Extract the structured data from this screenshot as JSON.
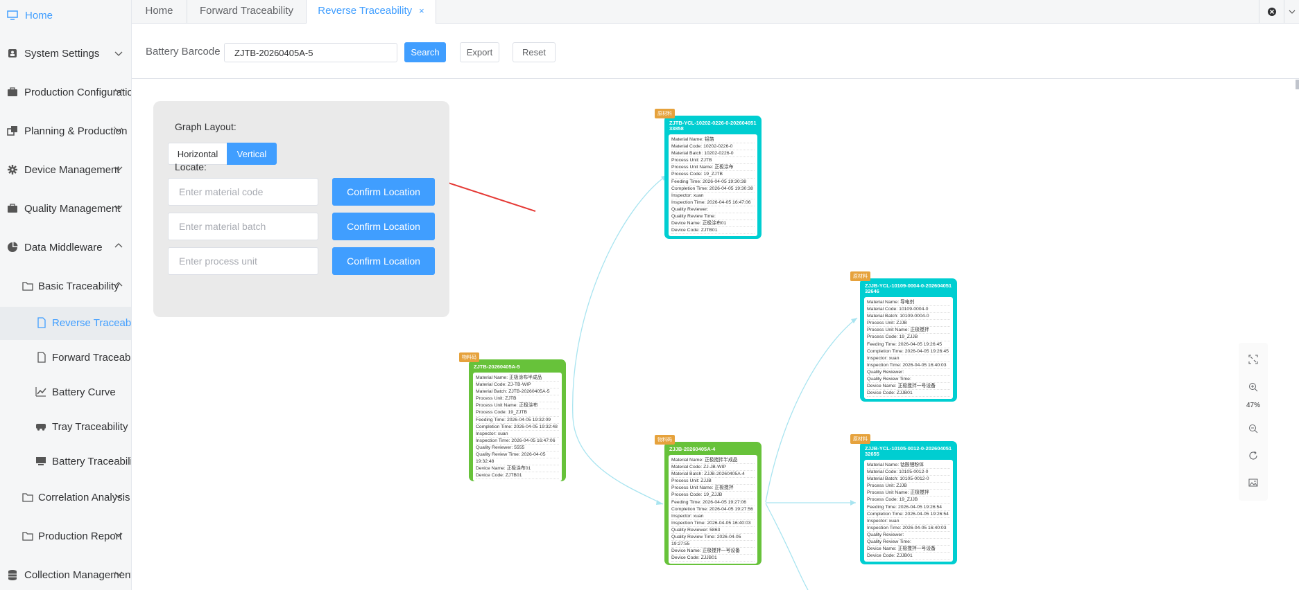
{
  "sidebar": {
    "items": [
      {
        "label": "Home",
        "icon": "monitor-icon"
      },
      {
        "label": "System Settings",
        "icon": "user-lock-icon"
      },
      {
        "label": "Production Configuration",
        "icon": "briefcase-icon"
      },
      {
        "label": "Planning & Production",
        "icon": "copy-icon"
      },
      {
        "label": "Device Management",
        "icon": "gear-icon"
      },
      {
        "label": "Quality Management",
        "icon": "briefcase-icon"
      },
      {
        "label": "Data Middleware",
        "icon": "pie-chart-icon"
      },
      {
        "label": "Basic Traceability",
        "icon": "folder-icon"
      },
      {
        "label": "Reverse Traceability",
        "icon": "document-icon"
      },
      {
        "label": "Forward Traceability",
        "icon": "document-icon"
      },
      {
        "label": "Battery Curve",
        "icon": "line-chart-icon"
      },
      {
        "label": "Tray Traceability",
        "icon": "truck-icon"
      },
      {
        "label": "Battery Traceability",
        "icon": "monitor-icon"
      },
      {
        "label": "Correlation Analysis",
        "icon": "folder-icon"
      },
      {
        "label": "Production Report",
        "icon": "folder-icon"
      },
      {
        "label": "Collection Management",
        "icon": "database-icon"
      }
    ]
  },
  "tabs": [
    {
      "label": "Home"
    },
    {
      "label": "Forward Traceability"
    },
    {
      "label": "Reverse Traceability",
      "close": "×"
    }
  ],
  "search": {
    "label": "Battery Barcode",
    "value": "ZJTB-20260405A-5",
    "search_label": "Search",
    "export_label": "Export",
    "reset_label": "Reset"
  },
  "panel": {
    "layout_title": "Graph Layout:",
    "horizontal_label": "Horizontal",
    "vertical_label": "Vertical",
    "locate_title": "Locate:",
    "material_code_placeholder": "Enter material code",
    "material_batch_placeholder": "Enter material batch",
    "process_unit_placeholder": "Enter process unit",
    "confirm_label": "Confirm Location"
  },
  "nodes": [
    {
      "tag": "物料码",
      "title": "ZJTB-20260405A-5",
      "color": "#67c23a",
      "rows": [
        "Material Name:  正极涂布半成品",
        "Material Code:  ZJ-TB-WIP",
        "Material Batch:  ZJTB-20260405A-5",
        "Process Unit:  ZJTB",
        "Process Unit Name:  正极涂布",
        "Process Code:  19_ZJTB",
        "Feeding Time:  2026-04-05 19:32:09",
        "Completion Time:  2026-04-05 19:32:48",
        "Inspector:  xuan",
        "Inspection Time:  2026-04-05 16:47:06",
        "Quality Reviewer:  5555",
        "Quality Review Time:  2026-04-05",
        "19:32:48",
        "Device Name:  正极涂布01",
        "Device Code:  ZJTB01"
      ]
    },
    {
      "tag": "原材料",
      "title": "ZJTB-YCL-10202-0226-0-20260405133858",
      "color": "#00ced1",
      "rows": [
        "Material Name:  铝箔",
        "Material Code:  10202-0226-0",
        "Material Batch:  10202-0226-0",
        "Process Unit:  ZJTB",
        "Process Unit Name:  正极涂布",
        "Process Code:  19_ZJTB",
        "Feeding Time:  2026-04-05 19:30:38",
        "Completion Time:  2026-04-05 19:30:38",
        "Inspector:  xuan",
        "Inspection Time:  2026-04-05 16:47:06",
        "Quality Reviewer:",
        "Quality Review Time:",
        "Device Name:  正极涂布01",
        "Device Code:  ZJTB01"
      ]
    },
    {
      "tag": "物料码",
      "title": "ZJJB-20260405A-4",
      "color": "#67c23a",
      "rows": [
        "Material Name:  正极搅拌半成品",
        "Material Code:  ZJ-JB-WIP",
        "Material Batch:  ZJJB-20260405A-4",
        "Process Unit:  ZJJB",
        "Process Unit Name:  正极搅拌",
        "Process Code:  19_ZJJB",
        "Feeding Time:  2026-04-05 19:27:06",
        "Completion Time:  2026-04-05 19:27:56",
        "Inspector:  xuan",
        "Inspection Time:  2026-04-05 16:40:03",
        "Quality Reviewer:  5863",
        "Quality Review Time:  2026-04-05",
        "19:27:55",
        "Device Name:  正极搅拌一号设备",
        "Device Code:  ZJJB01"
      ]
    },
    {
      "tag": "原材料",
      "title": "ZJJB-YCL-10109-0004-0-20260405132646",
      "color": "#00ced1",
      "rows": [
        "Material Name:  导电剂",
        "Material Code:  10109-0004-0",
        "Material Batch:  10109-0004-0",
        "Process Unit:  ZJJB",
        "Process Unit Name:  正极搅拌",
        "Process Code:  19_ZJJB",
        "Feeding Time:  2026-04-05 19:26:45",
        "Completion Time:  2026-04-05 19:26:45",
        "Inspector:  xuan",
        "Inspection Time:  2026-04-05 16:40:03",
        "Quality Reviewer:",
        "Quality Review Time:",
        "Device Name:  正极搅拌一号设备",
        "Device Code:  ZJJB01"
      ]
    },
    {
      "tag": "原材料",
      "title": "ZJJB-YCL-10105-0012-0-20260405132655",
      "color": "#00ced1",
      "rows": [
        "Material Name:  钴酸锂粉体",
        "Material Code:  10105-0012-0",
        "Material Batch:  10105-0012-0",
        "Process Unit:  ZJJB",
        "Process Unit Name:  正极搅拌",
        "Process Code:  19_ZJJB",
        "Feeding Time:  2026-04-05 19:26:54",
        "Completion Time:  2026-04-05 19:26:54",
        "Inspector:  xuan",
        "Inspection Time:  2026-04-05 16:40:03",
        "Quality Reviewer:",
        "Quality Review Time:",
        "Device Name:  正极搅拌一号设备",
        "Device Code:  ZJJB01"
      ]
    }
  ],
  "toolbar": {
    "zoom": "47%",
    "icons": [
      "fit-screen-icon",
      "zoom-in-icon",
      "zoom-out-icon",
      "refresh-icon",
      "image-export-icon"
    ]
  },
  "colors": {
    "primary": "#409eff",
    "node_green": "#67c23a",
    "node_teal": "#00ced1",
    "tag_orange": "#e6a23c",
    "link": "#a8e4f0",
    "arrow": "#e53935"
  }
}
